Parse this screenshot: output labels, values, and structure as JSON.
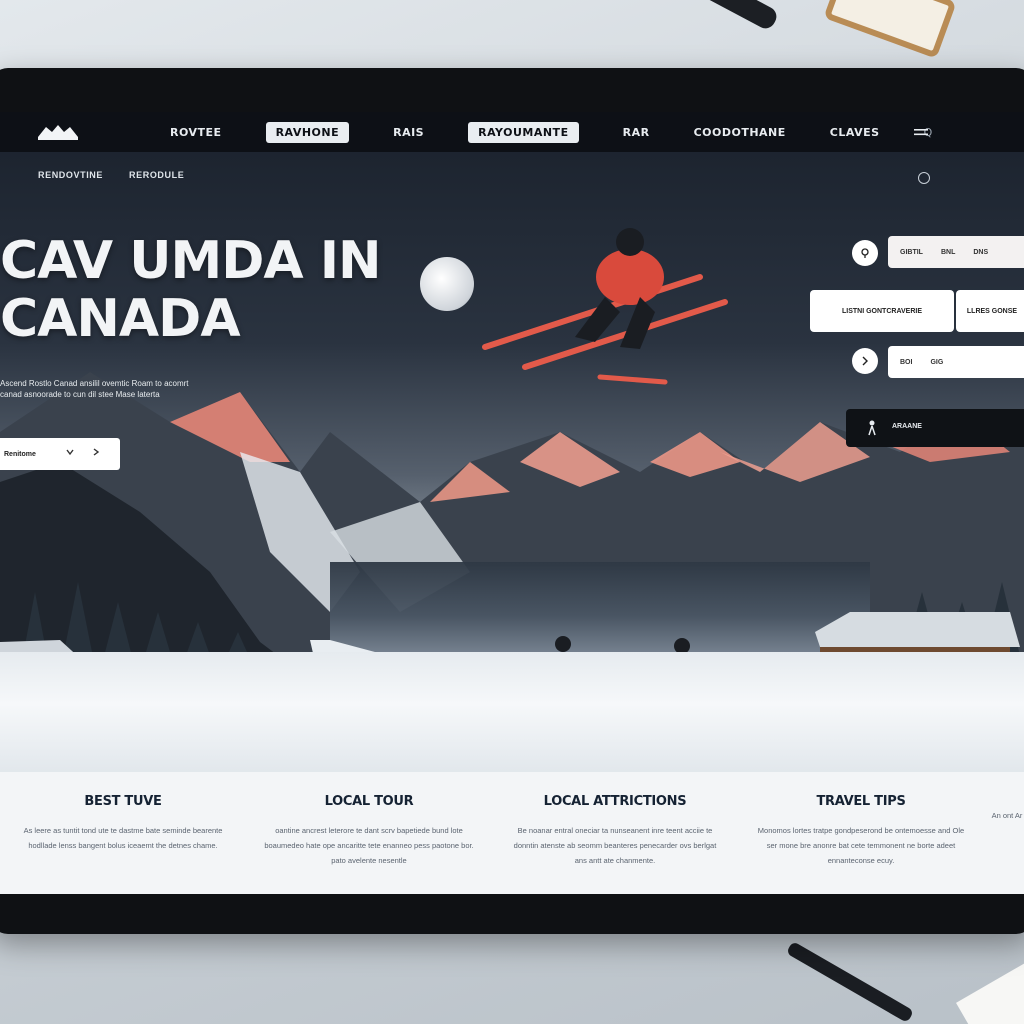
{
  "nav": {
    "items": [
      "ROVTEE",
      "RAVHONE",
      "RAIS",
      "RAYOUMANTE",
      "RAR",
      "COODOTHANE",
      "CLAVES"
    ],
    "search_hint": "Q"
  },
  "subnav": [
    "RENDOVTINE",
    "RERODULE"
  ],
  "hero": {
    "title_line1": "CAV UMDA IN",
    "title_line2": "CANADA",
    "subtitle": "Ascend Rostlo Canad ansilil ovemtic Roam to acomrt canad asnoorade to cun dil stee Mase laterta",
    "cta_label": "Renitome"
  },
  "widgets": {
    "pill1": [
      "GIBTIL",
      "BNL",
      "DNS"
    ],
    "card1": "LISTNI GONTCRAVERIE",
    "card2": "LLRES GONSE",
    "pill2": [
      "BOI",
      "GIG"
    ],
    "dark_card_label": "ARAANE"
  },
  "features": [
    {
      "title": "BEST TUVE",
      "text": "As leere as tuntit tond ute te dastme bate seminde bearente hodllade lenss bangent bolus iceaemt the detnes chame."
    },
    {
      "title": "LOCAL TOUR",
      "text": "oantine ancrest leterore te dant scrv bapetiede bund lote boaumedeo hate ope ancaritte tete enanneo pess paotone bor. pato avelente nesentle"
    },
    {
      "title": "LOCAL ATTRICTIONS",
      "text": "Be noanar entral oneciar ta nunseanent inre teent acciie te donntin atenste ab seomm beanteres penecarder ovs berlgat ans antt ate chanmente."
    },
    {
      "title": "TRAVEL TIPS",
      "text": "Monomos lortes tratpe gondpeserond be ontemoesse and Ole ser mone bre anonre bat cete temmonent ne borte adeet ennanteconse ecuy."
    },
    {
      "title": "",
      "text": "An ont Ar"
    }
  ],
  "colors": {
    "accent": "#e25a4a",
    "nav_bg": "#0d1016",
    "strip_bg": "#f3f5f7"
  }
}
